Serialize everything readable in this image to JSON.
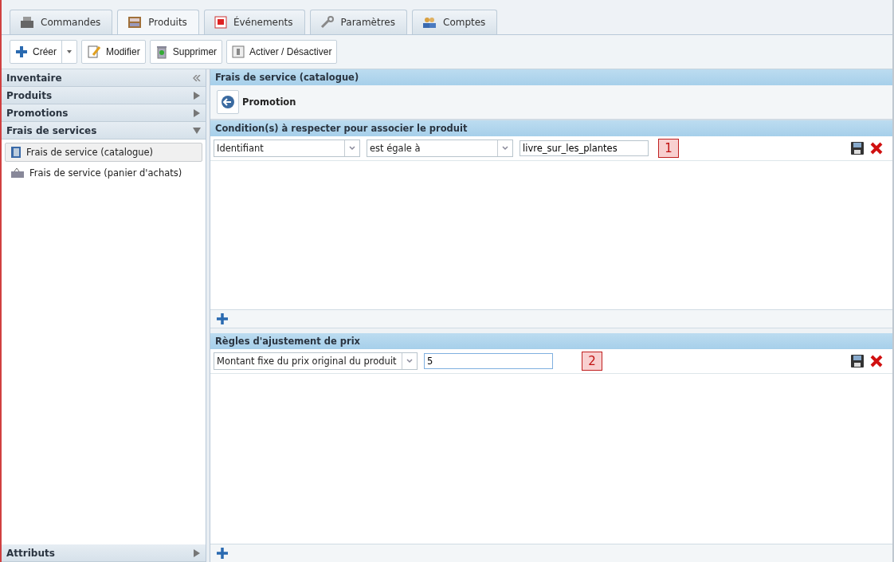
{
  "tabs": [
    {
      "label": "Commandes",
      "selected": false
    },
    {
      "label": "Produits",
      "selected": true
    },
    {
      "label": "Événements",
      "selected": false
    },
    {
      "label": "Paramètres",
      "selected": false
    },
    {
      "label": "Comptes",
      "selected": false
    }
  ],
  "toolbar": [
    {
      "label": "Créer",
      "kind": "split"
    },
    {
      "label": "Modifier",
      "kind": "button"
    },
    {
      "label": "Supprimer",
      "kind": "button"
    },
    {
      "label": "Activer / Désactiver",
      "kind": "button"
    }
  ],
  "sidebar": {
    "sections": [
      {
        "title": "Inventaire",
        "expanded": false
      },
      {
        "title": "Produits",
        "expanded": false
      },
      {
        "title": "Promotions",
        "expanded": false
      },
      {
        "title": "Frais de services",
        "expanded": true,
        "items": [
          {
            "label": "Frais de service (catalogue)",
            "selected": true
          },
          {
            "label": "Frais de service (panier d'achats)",
            "selected": false
          }
        ]
      }
    ],
    "footer": "Attributs"
  },
  "panel": {
    "title": "Frais de service (catalogue)",
    "back_label": "Promotion",
    "conditions": {
      "title": "Condition(s) à respecter pour associer le produit",
      "rows": [
        {
          "field": "Identifiant",
          "operator": "est égale à",
          "value": "livre_sur_les_plantes",
          "badge": "1",
          "focused": false
        }
      ]
    },
    "rules": {
      "title": "Règles d'ajustement de prix",
      "rows": [
        {
          "type": "Montant fixe du prix original du produit",
          "value": "5",
          "badge": "2",
          "focused": true
        }
      ]
    }
  }
}
